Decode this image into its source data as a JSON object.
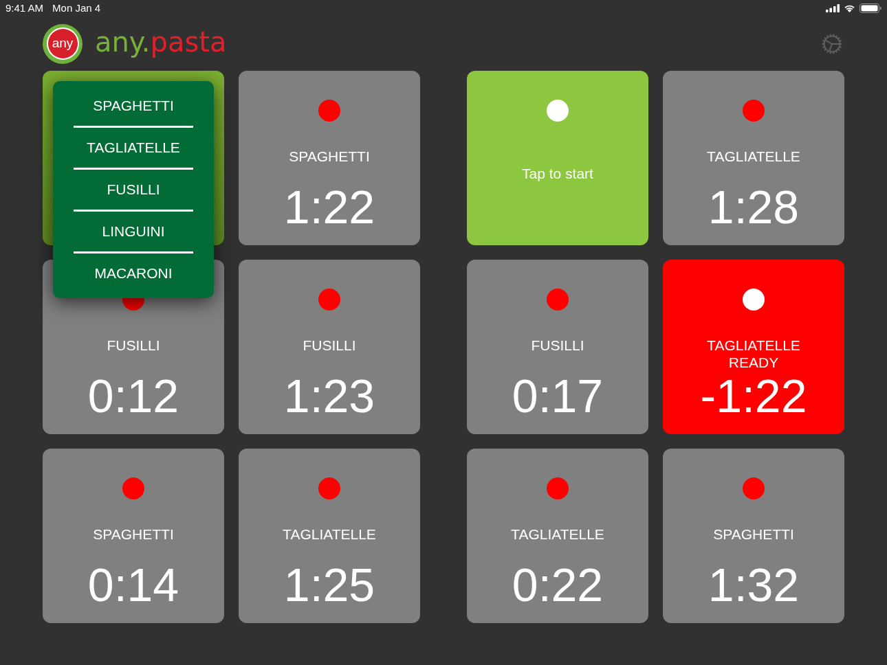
{
  "status_bar": {
    "time": "9:41 AM",
    "date": "Mon Jan 4"
  },
  "header": {
    "logo_emblem": "any",
    "logo_word_first": "any.",
    "logo_word_second": "pasta"
  },
  "tiles": [
    {
      "kind": "picking",
      "menu": [
        "SPAGHETTI",
        "TAGLIATELLE",
        "FUSILLI",
        "LINGUINI",
        "MACARONI"
      ]
    },
    {
      "kind": "timer",
      "pasta": "SPAGHETTI",
      "time": "1:22"
    },
    {
      "kind": "start",
      "prompt": "Tap to start"
    },
    {
      "kind": "timer",
      "pasta": "TAGLIATELLE",
      "time": "1:28"
    },
    {
      "kind": "timer",
      "pasta": "FUSILLI",
      "time": "0:12"
    },
    {
      "kind": "timer",
      "pasta": "FUSILLI",
      "time": "1:23"
    },
    {
      "kind": "timer",
      "pasta": "FUSILLI",
      "time": "0:17"
    },
    {
      "kind": "ready",
      "pasta": "TAGLIATELLE",
      "status": "READY",
      "time": "-1:22"
    },
    {
      "kind": "timer",
      "pasta": "SPAGHETTI",
      "time": "0:14"
    },
    {
      "kind": "timer",
      "pasta": "TAGLIATELLE",
      "time": "1:25"
    },
    {
      "kind": "timer",
      "pasta": "TAGLIATELLE",
      "time": "0:22"
    },
    {
      "kind": "timer",
      "pasta": "SPAGHETTI",
      "time": "1:32"
    }
  ]
}
